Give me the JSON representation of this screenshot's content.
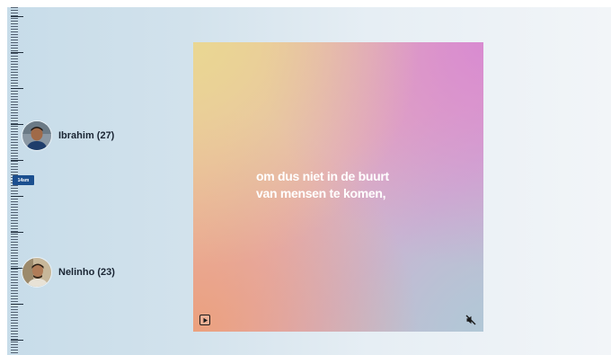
{
  "timeline": {
    "badge": "14sm"
  },
  "people": [
    {
      "name": "Ibrahim (27)"
    },
    {
      "name": "Nelinho (23)"
    }
  ],
  "video": {
    "caption_line1": "om dus niet in de buurt",
    "caption_line2": "van mensen te komen,",
    "play_icon": "play-icon",
    "mute_icon": "muted-speaker-icon"
  }
}
